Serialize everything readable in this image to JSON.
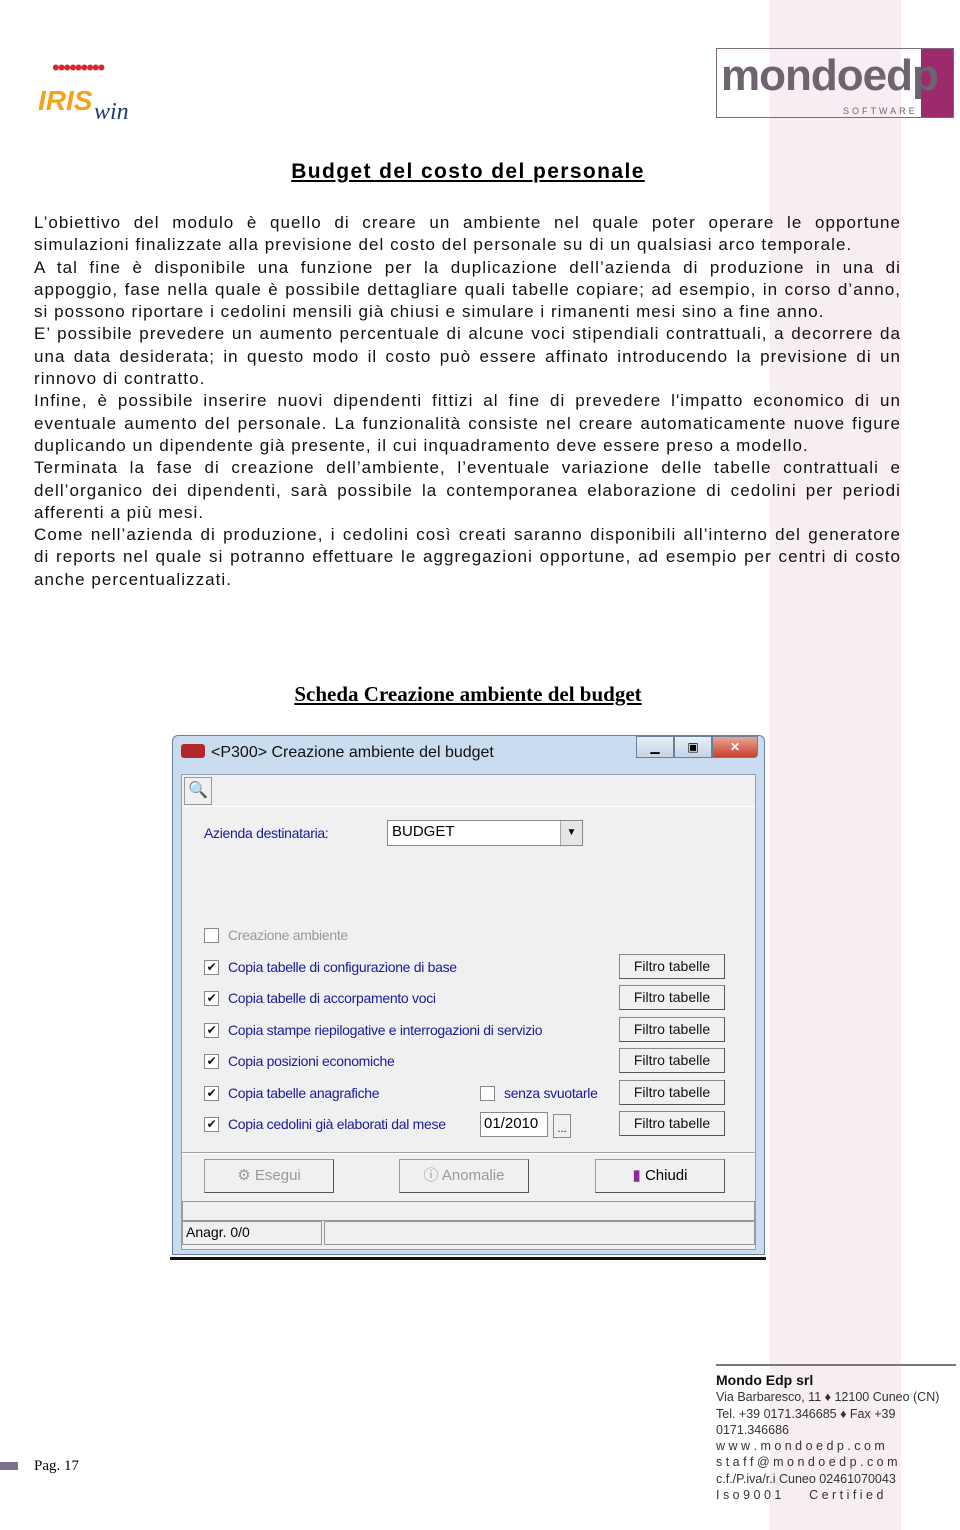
{
  "logos": {
    "left": "IRIS win",
    "right_main": "mondoedp",
    "right_sub": "SOFTWARE"
  },
  "title": "Budget del costo del personale",
  "paragraphs": [
    "L’obiettivo del modulo è quello di creare un ambiente nel quale poter operare le opportune simulazioni finalizzate alla previsione del costo del personale su di un qualsiasi arco temporale.",
    "A tal fine è disponibile una funzione per la duplicazione dell’azienda di produzione in una di appoggio, fase nella quale è possibile dettagliare quali tabelle copiare; ad esempio, in corso d’anno, si possono riportare i cedolini mensili già chiusi e simulare i rimanenti mesi sino a fine anno.",
    "E’ possibile prevedere un aumento percentuale di alcune voci stipendiali contrattuali, a decorrere da una data desiderata; in questo modo il costo può essere affinato introducendo la previsione di un rinnovo di contratto.",
    "Infine, è possibile inserire nuovi dipendenti fittizi al fine di prevedere l'impatto economico di un eventuale aumento del personale. La funzionalità consiste nel creare automaticamente nuove figure duplicando un dipendente già presente, il cui inquadramento deve essere preso a modello.",
    "Terminata la fase di creazione dell’ambiente, l’eventuale variazione delle tabelle contrattuali e dell’organico dei dipendenti, sarà possibile la contemporanea elaborazione di cedolini per periodi afferenti a più mesi.",
    "Come nell’azienda di produzione, i cedolini così creati saranno disponibili all’interno del generatore di reports nel quale si potranno effettuare le aggregazioni opportune, ad esempio per centri di costo anche percentualizzati."
  ],
  "figure_title": "Scheda Creazione ambiente del budget",
  "dialog": {
    "title": "<P300> Creazione ambiente del budget",
    "azienda_label": "Azienda destinataria:",
    "azienda_value": "BUDGET",
    "options": [
      {
        "label": "Creazione ambiente",
        "checked": false,
        "disabled": true
      },
      {
        "label": "Copia tabelle di configurazione di base",
        "checked": true,
        "filter": "Filtro tabelle"
      },
      {
        "label": "Copia tabelle di accorpamento voci",
        "checked": true,
        "filter": "Filtro tabelle"
      },
      {
        "label": "Copia stampe riepilogative e interrogazioni di servizio",
        "checked": true,
        "filter": "Filtro tabelle"
      },
      {
        "label": "Copia posizioni economiche",
        "checked": true,
        "filter": "Filtro tabelle"
      },
      {
        "label": "Copia tabelle anagrafiche",
        "checked": true,
        "filter": "Filtro tabelle"
      },
      {
        "label": "Copia cedolini già elaborati dal mese",
        "checked": true,
        "filter": "Filtro tabelle"
      }
    ],
    "senza_svuotarle": "senza svuotarle",
    "month_value": "01/2010",
    "ellipsis": "...",
    "buttons": {
      "esegui": "Esegui",
      "anomalie": "Anomalie",
      "chiudi": "Chiudi"
    },
    "status": "Anagr. 0/0"
  },
  "footer": {
    "company": "Mondo Edp srl",
    "lines": [
      "Via Barbaresco, 11 ♦ 12100 Cuneo (CN)",
      "Tel. +39 0171.346685 ♦ Fax +39 0171.346686",
      "w w w . m o n d o e d p . c o m",
      "s t a f f @ m o n d o e d p . c o m",
      "c.f./P.iva/r.i  Cuneo  02461070043",
      "I s o 9 0 0 1        C e r t i f i e d"
    ],
    "page": "Pag. 17"
  }
}
